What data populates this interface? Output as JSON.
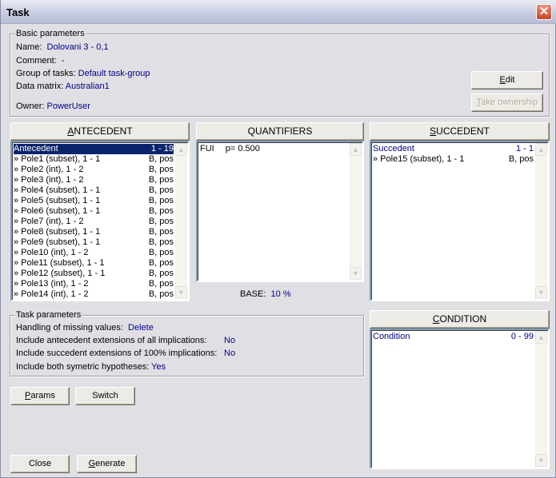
{
  "window": {
    "title": "Task",
    "close_icon": "close-icon"
  },
  "basic": {
    "group_label": "Basic parameters",
    "name_label": "Name:",
    "name_value": "Dolovani 3 - 0,1",
    "comment_label": "Comment:",
    "comment_value": "-",
    "group_label2": "Group of tasks:",
    "group_value": "Default task-group",
    "matrix_label": "Data matrix:",
    "matrix_value": "Australian1",
    "owner_label": "Owner:",
    "owner_value": "PowerUser",
    "edit": "Edit",
    "take_ownership": "Take ownership"
  },
  "antecedent": {
    "header": "ANTECEDENT",
    "rows": [
      {
        "left": "Antecedent",
        "right": "1 - 19",
        "selected": true
      },
      {
        "left": "» Pole1 (subset), 1 - 1",
        "right": "B, pos"
      },
      {
        "left": "» Pole2 (int), 1 - 2",
        "right": "B, pos"
      },
      {
        "left": "» Pole3 (int), 1 - 2",
        "right": "B, pos"
      },
      {
        "left": "» Pole4 (subset), 1 - 1",
        "right": "B, pos"
      },
      {
        "left": "» Pole5 (subset), 1 - 1",
        "right": "B, pos"
      },
      {
        "left": "» Pole6 (subset), 1 - 1",
        "right": "B, pos"
      },
      {
        "left": "» Pole7 (int), 1 - 2",
        "right": "B, pos"
      },
      {
        "left": "» Pole8 (subset), 1 - 1",
        "right": "B, pos"
      },
      {
        "left": "» Pole9 (subset), 1 - 1",
        "right": "B, pos"
      },
      {
        "left": "» Pole10 (int), 1 - 2",
        "right": "B, pos"
      },
      {
        "left": "» Pole11 (subset), 1 - 1",
        "right": "B, pos"
      },
      {
        "left": "» Pole12 (subset), 1 - 1",
        "right": "B, pos"
      },
      {
        "left": "» Pole13 (int), 1 - 2",
        "right": "B, pos"
      },
      {
        "left": "» Pole14 (int), 1 - 2",
        "right": "B, pos"
      }
    ]
  },
  "quantifiers": {
    "header": "QUANTIFIERS",
    "rows": [
      {
        "name": "FUI",
        "param": "p= 0.500"
      }
    ],
    "base_label": "BASE:",
    "base_value": "10 %"
  },
  "succedent": {
    "header": "SUCCEDENT",
    "rows": [
      {
        "left": "Succedent",
        "right": "1 - 1",
        "title": true
      },
      {
        "left": "» Pole15 (subset), 1 - 1",
        "right": "B, pos"
      }
    ]
  },
  "task": {
    "group_label": "Task parameters",
    "missing_label": "Handling of missing values:",
    "missing_value": "Delete",
    "ante_ext_label": "Include antecedent extensions of all implications:",
    "ante_ext_value": "No",
    "succ_ext_label": "Include succedent extensions of 100% implications:",
    "succ_ext_value": "No",
    "sym_label": "Include both symetric hypotheses:",
    "sym_value": "Yes"
  },
  "condition": {
    "header": "CONDITION",
    "rows": [
      {
        "left": "Condition",
        "right": "0 - 99",
        "title": true
      }
    ]
  },
  "buttons": {
    "params": "Params",
    "switch": "Switch",
    "close": "Close",
    "generate": "Generate"
  },
  "colors": {
    "value_text": "#00008b",
    "selection": "#0a246a"
  }
}
